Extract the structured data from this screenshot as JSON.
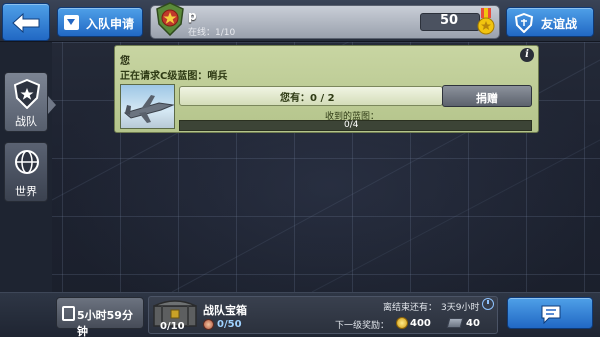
{
  "header": {
    "apply_label": "入队申请",
    "squad_name": "p",
    "squad_online": "在线：1/10",
    "score": "50",
    "friendly_battle_label": "友谊战"
  },
  "sidebar": {
    "items": [
      {
        "label": "战队",
        "active": true
      },
      {
        "label": "世界",
        "active": false
      }
    ]
  },
  "request": {
    "user": "您",
    "text": "正在请求C级蓝图：哨兵",
    "have_text": "您有：0 / 2",
    "donate_label": "捐赠",
    "received_label": "收到的蓝图：",
    "received_progress": "0/4",
    "received_fraction": 0
  },
  "footer": {
    "timer_label": "5小时59分钟",
    "chest_title": "战队宝箱",
    "chest_count": "0/10",
    "tokens": "0/50",
    "ends_label": "离结束还有：",
    "ends_value": "3天9小时",
    "next_reward_label": "下一级奖励：",
    "reward_gold": "400",
    "reward_parts": "40"
  },
  "colors": {
    "accent_blue": "#2f7fd8",
    "card_green": "#bfcd96"
  }
}
